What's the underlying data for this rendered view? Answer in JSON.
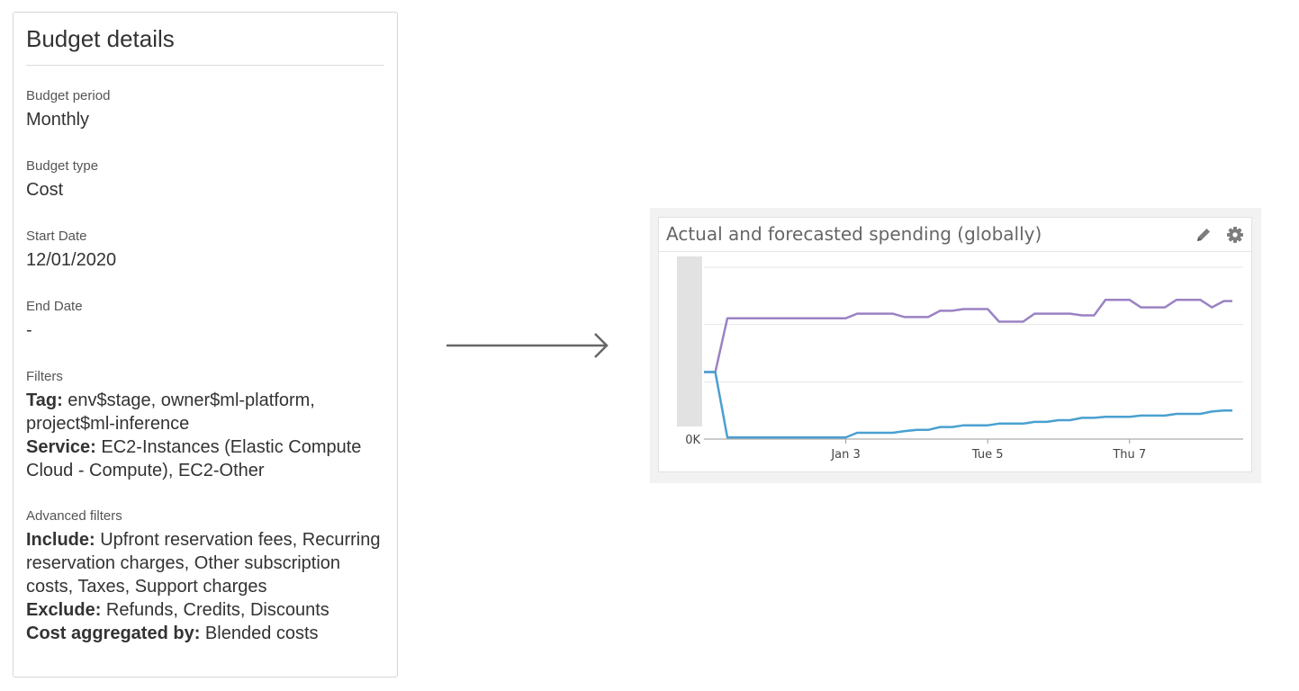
{
  "budget_details": {
    "title": "Budget details",
    "period": {
      "label": "Budget period",
      "value": "Monthly"
    },
    "type": {
      "label": "Budget type",
      "value": "Cost"
    },
    "start_date": {
      "label": "Start Date",
      "value": "12/01/2020"
    },
    "end_date": {
      "label": "End Date",
      "value": "-"
    },
    "filters": {
      "label": "Filters",
      "tag_key": "Tag:",
      "tag_value": " env$stage, owner$ml-platform, project$ml-inference",
      "service_key": "Service:",
      "service_value": " EC2-Instances (Elastic Compute Cloud - Compute), EC2-Other"
    },
    "advanced_filters": {
      "label": "Advanced filters",
      "include_key": "Include:",
      "include_value": " Upfront reservation fees, Recurring reservation charges, Other subscription costs, Taxes, Support charges",
      "exclude_key": "Exclude:",
      "exclude_value": " Refunds, Credits, Discounts",
      "aggregated_key": "Cost aggregated by:",
      "aggregated_value": " Blended costs"
    }
  },
  "widget": {
    "title": "Actual and forecasted spending (globally)",
    "edit_icon": "pencil-icon",
    "settings_icon": "gear-icon"
  },
  "chart_data": {
    "type": "line",
    "title": "Actual and forecasted spending (globally)",
    "y_tick_labels": [
      "0K"
    ],
    "x_tick_labels": [
      "Jan 3",
      "Tue 5",
      "Thu 7"
    ],
    "x_ticks_at": [
      3,
      5,
      7
    ],
    "xlim": [
      1.0,
      8.45
    ],
    "ylim": [
      0,
      3
    ],
    "grid": true,
    "colors": {
      "forecast": "#9b82c4",
      "actual": "#4aa0d0",
      "shade": "#e2e2e2"
    },
    "x": [
      1.0,
      1.16,
      1.33,
      1.5,
      1.66,
      1.83,
      2.0,
      2.16,
      2.33,
      2.5,
      2.66,
      2.83,
      3.0,
      3.16,
      3.33,
      3.5,
      3.66,
      3.83,
      4.0,
      4.16,
      4.33,
      4.5,
      4.66,
      4.83,
      5.0,
      5.16,
      5.33,
      5.5,
      5.66,
      5.83,
      6.0,
      6.16,
      6.33,
      6.5,
      6.66,
      6.83,
      7.0,
      7.16,
      7.33,
      7.5,
      7.66,
      7.83,
      8.0,
      8.16,
      8.33,
      8.45
    ],
    "series": [
      {
        "values": [
          1.17,
          1.17,
          2.11,
          2.11,
          2.11,
          2.11,
          2.11,
          2.11,
          2.11,
          2.11,
          2.11,
          2.11,
          2.11,
          2.19,
          2.19,
          2.19,
          2.19,
          2.13,
          2.13,
          2.13,
          2.24,
          2.24,
          2.27,
          2.27,
          2.27,
          2.05,
          2.05,
          2.05,
          2.19,
          2.19,
          2.19,
          2.19,
          2.16,
          2.16,
          2.43,
          2.43,
          2.43,
          2.3,
          2.3,
          2.3,
          2.43,
          2.43,
          2.43,
          2.3,
          2.41,
          2.41
        ]
      },
      {
        "values": [
          1.17,
          1.17,
          0.03,
          0.03,
          0.03,
          0.03,
          0.03,
          0.03,
          0.03,
          0.03,
          0.03,
          0.03,
          0.03,
          0.11,
          0.11,
          0.11,
          0.11,
          0.14,
          0.16,
          0.16,
          0.21,
          0.21,
          0.24,
          0.24,
          0.24,
          0.27,
          0.27,
          0.27,
          0.3,
          0.3,
          0.33,
          0.33,
          0.37,
          0.37,
          0.39,
          0.39,
          0.39,
          0.41,
          0.41,
          0.41,
          0.44,
          0.44,
          0.44,
          0.48,
          0.5,
          0.5
        ]
      }
    ]
  }
}
